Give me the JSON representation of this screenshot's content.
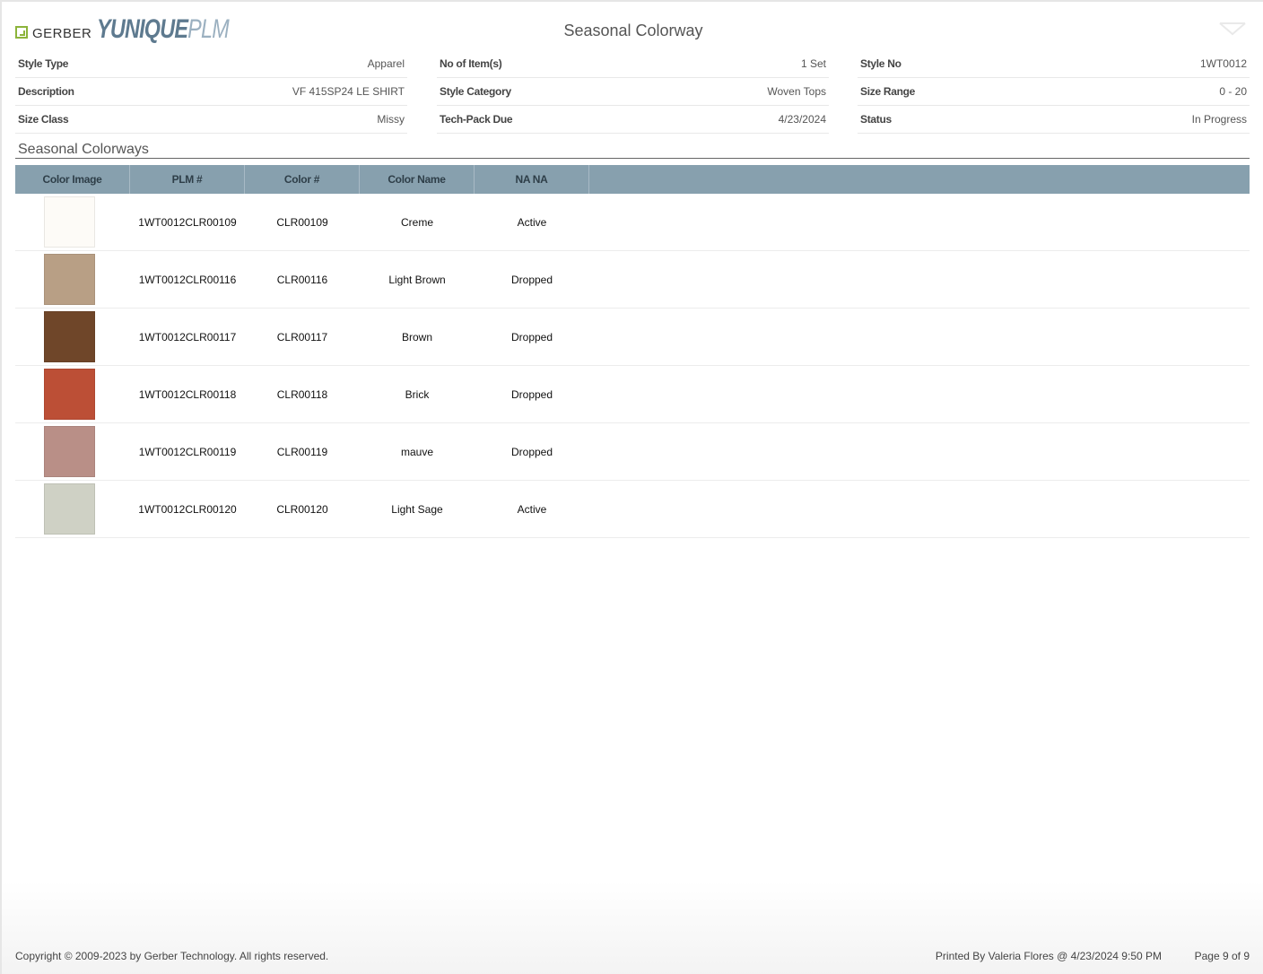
{
  "header": {
    "brand": "GERBER",
    "product_main": "YUNIQUE",
    "product_sub": "PLM",
    "title": "Seasonal Colorway"
  },
  "info": {
    "col1": [
      {
        "label": "Style Type",
        "value": "Apparel"
      },
      {
        "label": "Description",
        "value": "VF 415SP24 LE SHIRT"
      },
      {
        "label": "Size Class",
        "value": "Missy"
      }
    ],
    "col2": [
      {
        "label": "No of Item(s)",
        "value": "1 Set"
      },
      {
        "label": "Style Category",
        "value": "Woven Tops"
      },
      {
        "label": "Tech-Pack Due",
        "value": "4/23/2024"
      }
    ],
    "col3": [
      {
        "label": "Style No",
        "value": "1WT0012"
      },
      {
        "label": "Size Range",
        "value": "0 - 20"
      },
      {
        "label": "Status",
        "value": "In Progress"
      }
    ]
  },
  "section": {
    "title": "Seasonal Colorways"
  },
  "table": {
    "columns": [
      "Color Image",
      "PLM #",
      "Color #",
      "Color Name",
      "NA NA"
    ],
    "rows": [
      {
        "swatch_color": "#fdfbf7",
        "plm": "1WT0012CLR00109",
        "color_no": "CLR00109",
        "color_name": "Creme",
        "status": "Active"
      },
      {
        "swatch_color": "#b89f85",
        "plm": "1WT0012CLR00116",
        "color_no": "CLR00116",
        "color_name": "Light Brown",
        "status": "Dropped"
      },
      {
        "swatch_color": "#6f4629",
        "plm": "1WT0012CLR00117",
        "color_no": "CLR00117",
        "color_name": "Brown",
        "status": "Dropped"
      },
      {
        "swatch_color": "#bc4f36",
        "plm": "1WT0012CLR00118",
        "color_no": "CLR00118",
        "color_name": "Brick",
        "status": "Dropped"
      },
      {
        "swatch_color": "#b98f87",
        "plm": "1WT0012CLR00119",
        "color_no": "CLR00119",
        "color_name": "mauve",
        "status": "Dropped"
      },
      {
        "swatch_color": "#cfd1c5",
        "plm": "1WT0012CLR00120",
        "color_no": "CLR00120",
        "color_name": "Light Sage",
        "status": "Active"
      }
    ]
  },
  "footer": {
    "copyright": "Copyright © 2009-2023 by Gerber Technology. All rights reserved.",
    "printed_by": "Printed By Valeria Flores @ 4/23/2024 9:50 PM",
    "page": "Page 9 of 9"
  },
  "colors": {
    "header_bar": "#87a0ae",
    "brand_green": "#8cb43b",
    "brand_blue": "#5e7a8f"
  }
}
